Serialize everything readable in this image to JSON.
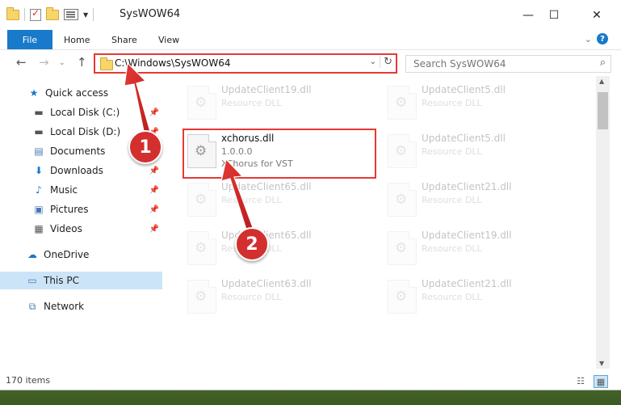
{
  "window": {
    "title": "SysWOW64",
    "controls": {
      "minimize": "—",
      "maximize": "☐",
      "close": "✕"
    }
  },
  "ribbon": {
    "tabs": [
      "File",
      "Home",
      "Share",
      "View"
    ],
    "help": "?"
  },
  "address": {
    "path": "C:\\Windows\\SysWOW64",
    "search_placeholder": "Search SysWOW64"
  },
  "sidebar": {
    "items": [
      {
        "label": "Quick access",
        "icon": "star-icon"
      },
      {
        "label": "Local Disk (C:)",
        "icon": "drive-icon"
      },
      {
        "label": "Local Disk (D:)",
        "icon": "drive-icon"
      },
      {
        "label": "Documents",
        "icon": "documents-icon"
      },
      {
        "label": "Downloads",
        "icon": "download-icon"
      },
      {
        "label": "Music",
        "icon": "music-icon"
      },
      {
        "label": "Pictures",
        "icon": "pictures-icon"
      },
      {
        "label": "Videos",
        "icon": "videos-icon"
      },
      {
        "label": "OneDrive",
        "icon": "cloud-icon"
      },
      {
        "label": "This PC",
        "icon": "computer-icon"
      },
      {
        "label": "Network",
        "icon": "network-icon"
      }
    ]
  },
  "files": [
    {
      "name": "UpdateClient19.dll",
      "line2": "Resource DLL",
      "line3": ""
    },
    {
      "name": "UpdateClient5.dll",
      "line2": "Resource DLL",
      "line3": ""
    },
    {
      "name": "xchorus.dll",
      "line2": "1.0.0.0",
      "line3": "XChorus for VST"
    },
    {
      "name": "UpdateClient5.dll",
      "line2": "Resource DLL",
      "line3": ""
    },
    {
      "name": "UpdateClient65.dll",
      "line2": "Resource DLL",
      "line3": ""
    },
    {
      "name": "UpdateClient21.dll",
      "line2": "Resource DLL",
      "line3": ""
    },
    {
      "name": "UpdateClient65.dll",
      "line2": "Resource DLL",
      "line3": ""
    },
    {
      "name": "UpdateClient19.dll",
      "line2": "Resource DLL",
      "line3": ""
    },
    {
      "name": "UpdateClient63.dll",
      "line2": "Resource DLL",
      "line3": ""
    },
    {
      "name": "UpdateClient21.dll",
      "line2": "Resource DLL",
      "line3": ""
    }
  ],
  "status": {
    "count": "170 items"
  },
  "annotations": {
    "badge1": "1",
    "badge2": "2"
  },
  "colors": {
    "accent": "#1979ca",
    "highlight": "#e53935",
    "badge": "#d32f2f",
    "selected": "#cce4f7"
  }
}
